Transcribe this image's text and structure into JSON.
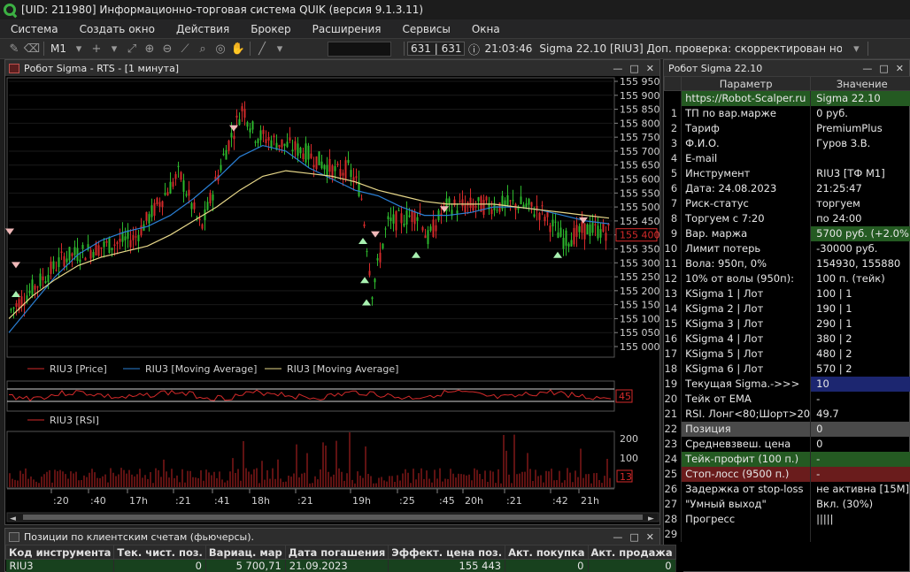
{
  "window": {
    "title": "[UID: 211980] Информационно-торговая система QUIK (версия 9.1.3.11)"
  },
  "menu": [
    "Система",
    "Создать окно",
    "Действия",
    "Брокер",
    "Расширения",
    "Сервисы",
    "Окна"
  ],
  "toolbar": {
    "interval": "M1",
    "counter": "631 | 631",
    "time": "21:03:46",
    "message": "Sigma 22.10 [RIU3] Доп. проверка: скорректирован номер..."
  },
  "chart_window": {
    "title": "Робот Sigma - RTS   - [1 минута]"
  },
  "chart_data": [
    {
      "type": "line",
      "subtype": "candlestick",
      "price_axis": [
        "155 950",
        "155 900",
        "155 850",
        "155 800",
        "155 750",
        "155 700",
        "155 650",
        "155 600",
        "155 550",
        "155 500",
        "155 450",
        "155 400",
        "155 350",
        "155 300",
        "155 250",
        "155 200",
        "155 150",
        "155 100",
        "155 050",
        "155 000"
      ],
      "ylim": [
        155000,
        155950
      ],
      "last_price": "155 400",
      "time_ticks": [
        ":20",
        ":40",
        "17h",
        ":21",
        ":41",
        "18h",
        ":21",
        "19h",
        ":25",
        ":45",
        "20h",
        ":21",
        ":42",
        "21h"
      ],
      "legend": [
        "RIU3 [Price]",
        "RIU3 [Moving Average]",
        "RIU3 [Moving Average]"
      ],
      "colors": {
        "up": "#2db82d",
        "down": "#d42a2a",
        "ma_fast": "#2a7fd4",
        "ma_slow": "#e8d88a"
      },
      "series": [
        {
          "name": "RIU3 [Moving Average]",
          "values": [
            155050,
            155150,
            155250,
            155330,
            155380,
            155410,
            155430,
            155470,
            155530,
            155600,
            155680,
            155720,
            155700,
            155640,
            155600,
            155560,
            155540,
            155500,
            155470,
            155470,
            155480,
            155500,
            155500,
            155490,
            155470,
            155450,
            155440
          ]
        },
        {
          "name": "RIU3 [Moving Average]",
          "values": [
            155100,
            155180,
            155240,
            155290,
            155320,
            155340,
            155360,
            155400,
            155450,
            155500,
            155560,
            155610,
            155630,
            155620,
            155610,
            155590,
            155560,
            155540,
            155520,
            155510,
            155510,
            155510,
            155500,
            155490,
            155480,
            155470,
            155460
          ]
        }
      ]
    },
    {
      "type": "line",
      "title": "RIU3 [RSI]",
      "level": "45"
    },
    {
      "type": "bar",
      "axis": [
        "200",
        "100"
      ],
      "value_label": "13"
    }
  ],
  "robot": {
    "title": "Робот Sigma 22.10",
    "headers": [
      "Параметр",
      "Значение"
    ],
    "rows": [
      {
        "n": "",
        "p": "https://Robot-Scalper.ru",
        "v": "Sigma 22.10",
        "pbg": "#245a22",
        "vbg": "#245a22"
      },
      {
        "n": "1",
        "p": "ТП по вар.марже",
        "v": "0 руб."
      },
      {
        "n": "2",
        "p": "Тариф",
        "v": "PremiumPlus"
      },
      {
        "n": "3",
        "p": "Ф.И.О.",
        "v": "Гуров З.В."
      },
      {
        "n": "4",
        "p": "E-mail",
        "v": ""
      },
      {
        "n": "5",
        "p": "Инструмент",
        "v": "RIU3 [ТФ M1]"
      },
      {
        "n": "6",
        "p": "Дата: 24.08.2023",
        "v": "21:25:47"
      },
      {
        "n": "7",
        "p": "Риск-статус",
        "v": "торгуем"
      },
      {
        "n": "8",
        "p": "Торгуем с 7:20",
        "v": "по 24:00"
      },
      {
        "n": "9",
        "p": "Вар. маржа",
        "v": "5700 руб. (+2.0%)",
        "vbg": "#245a22"
      },
      {
        "n": "10",
        "p": "Лимит потерь",
        "v": "-30000 руб."
      },
      {
        "n": "11",
        "p": "Вола: 950п, 0%",
        "v": "154930, 155880"
      },
      {
        "n": "12",
        "p": "10% от волы (950п):",
        "v": "100 п. (тейк)"
      },
      {
        "n": "13",
        "p": "KSigma 1 | Лот",
        "v": "100 | 1"
      },
      {
        "n": "14",
        "p": "KSigma 2 | Лот",
        "v": "190 | 1"
      },
      {
        "n": "15",
        "p": "KSigma 3 | Лот",
        "v": "290 | 1"
      },
      {
        "n": "16",
        "p": "KSigma 4 | Лот",
        "v": "380 | 2"
      },
      {
        "n": "17",
        "p": "KSigma 5 | Лот",
        "v": "480 | 2"
      },
      {
        "n": "18",
        "p": "KSigma 6 | Лот",
        "v": "570 | 2"
      },
      {
        "n": "19",
        "p": "Текущая Sigma.->>>",
        "v": "10",
        "vbg": "#1c2670"
      },
      {
        "n": "20",
        "p": "Тейк от EMA",
        "v": "-"
      },
      {
        "n": "21",
        "p": "RSI. Лонг<80;Шорт>20",
        "v": "49.7"
      },
      {
        "n": "22",
        "p": "Позиция",
        "v": "0",
        "pbg": "#4a4a4a",
        "vbg": "#4a4a4a"
      },
      {
        "n": "23",
        "p": "Средневзвеш. цена",
        "v": "0"
      },
      {
        "n": "24",
        "p": "Тейк-профит (100 п.)",
        "v": "-",
        "pbg": "#245a22",
        "vbg": "#245a22"
      },
      {
        "n": "25",
        "p": "Стоп-лосс (9500 п.)",
        "v": "-",
        "pbg": "#6a1c1c",
        "vbg": "#6a1c1c"
      },
      {
        "n": "26",
        "p": "Задержка от stop-loss",
        "v": "не активна [15M]"
      },
      {
        "n": "27",
        "p": "\"Умный выход\"",
        "v": "Вкл. (30%)"
      },
      {
        "n": "28",
        "p": "Прогресс",
        "v": "|||||"
      },
      {
        "n": "29",
        "p": "",
        "v": ""
      }
    ]
  },
  "positions": {
    "title": "Позиции по клиентским счетам (фьючерсы).",
    "headers": [
      "Код инструмента",
      "Тек. чист. поз.",
      "Вариац. мар",
      "Дата погашения",
      "Эффект. цена поз.",
      "Акт. покупка",
      "Акт. продажа"
    ],
    "row": [
      "RIU3",
      "0",
      "5 700,71",
      "21.09.2023",
      "155 443",
      "0",
      "0"
    ]
  }
}
